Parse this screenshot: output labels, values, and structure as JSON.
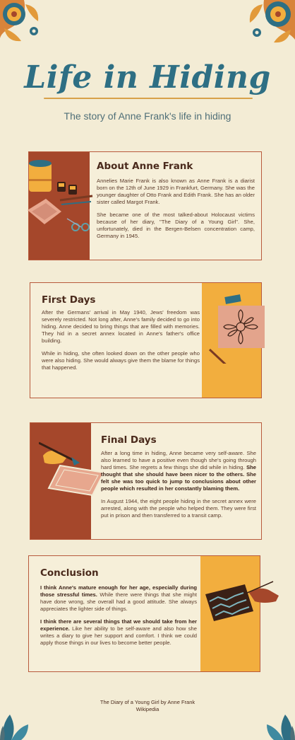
{
  "page": {
    "title": "Life in Hiding",
    "subtitle": "The story of Anne Frank's life in hiding"
  },
  "sections": {
    "about": {
      "heading": "About Anne Frank",
      "p1": "Annelies Marie Frank is also known as Anne Frank is a diarist born on the 12th of June 1929 in Frankfurt, Germany. She was the younger daughter of Otto Frank and Edith Frank. She has an older sister called Margot Frank.",
      "p2": "She became one of the most talked-about Holocaust victims because of her diary, \"The Diary of a Young Girl\". She, unfortunately, died in the Bergen-Belsen concentration camp, Germany in 1945."
    },
    "first_days": {
      "heading": "First Days",
      "p1": "After the Germans' arrival in May 1940, Jews' freedom was severely restricted. Not long after, Anne's family decided to go into hiding. Anne decided to bring things that are filled with memories. They hid in a secret annex located in Anne's father's office building.",
      "p2": "While in hiding, she often looked down on the other people who were also hiding. She would always give them the blame for things that happened."
    },
    "final_days": {
      "heading": "Final Days",
      "p1_a": "After a long time in hiding, Anne became very self-aware. She also learned to have a positive even though she's going through hard times. She regrets a few things she did while in hiding. ",
      "p1_b": "She thought that she should have been nicer to the others. She felt she was too quick to jump to conclusions about other people which resulted in her constantly blaming them.",
      "p2": "In August 1944, the eight people hiding in the secret annex were arrested, along with the people who helped them. They were first put in prison and then transferred to a transit camp."
    },
    "conclusion": {
      "heading": "Conclusion",
      "p1_a": "I think Anne's mature enough for her age, especially during those stressful times.",
      "p1_b": " While there were things that she might have done wrong, she overall had a good attitude. She always appreciates the lighter side of things.",
      "p2_a": "I think there are several things that we should take from her experience.",
      "p2_b": " Like her ability to be self-aware and also how she writes a diary to give her support and comfort. I think we could apply those things in our lives to become better people."
    }
  },
  "footer": {
    "line1": "The Diary of a Young Girl by Anne Frank",
    "line2": "Wikipedia"
  },
  "colors": {
    "background": "#f3ecd5",
    "rust": "#a5472b",
    "gold": "#f2ae3e",
    "title_teal": "#2e6f84",
    "text_brown": "#4a2a1c"
  },
  "icons": {
    "top_left": "floral-ornament-icon",
    "top_right": "floral-ornament-icon",
    "bottom_left": "leaf-icon",
    "bottom_right": "leaf-icon"
  }
}
